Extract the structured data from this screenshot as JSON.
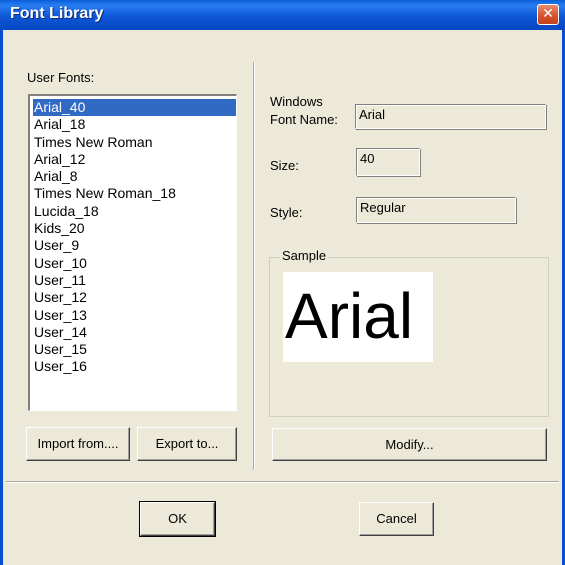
{
  "window": {
    "title": "Font Library",
    "close_glyph": "✕"
  },
  "user_fonts": {
    "label": "User Fonts:",
    "items": [
      "Arial_40",
      "Arial_18",
      "Times New Roman",
      "Arial_12",
      "Arial_8",
      "Times New Roman_18",
      "Lucida_18",
      "Kids_20",
      "User_9",
      "User_10",
      "User_11",
      "User_12",
      "User_13",
      "User_14",
      "User_15",
      "User_16"
    ],
    "selected": "Arial_40"
  },
  "buttons": {
    "import": "Import from....",
    "export": "Export to...",
    "modify": "Modify...",
    "ok": "OK",
    "cancel": "Cancel"
  },
  "details": {
    "font_name_label_1": "Windows",
    "font_name_label_2": "Font Name:",
    "font_name_value": "Arial",
    "size_label": "Size:",
    "size_value": "40",
    "style_label": "Style:",
    "style_value": "Regular"
  },
  "sample": {
    "caption": "Sample",
    "text": "Arial"
  },
  "colors": {
    "titlebar": "#0a5fd8",
    "selection": "#316ac5",
    "dialog_bg": "#ece9d8",
    "close_button": "#d4502c"
  },
  "icons": {
    "close": "close-icon"
  }
}
